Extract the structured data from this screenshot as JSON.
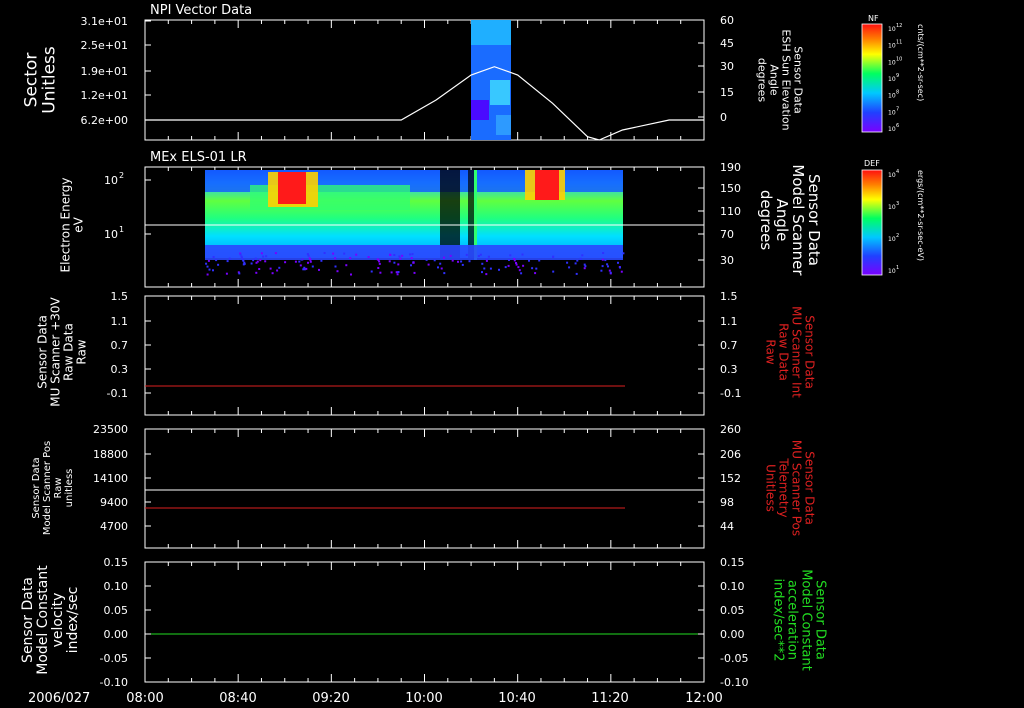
{
  "date_label": "2006/027",
  "time_ticks": [
    "08:00",
    "08:40",
    "09:20",
    "10:00",
    "10:40",
    "11:20",
    "12:00"
  ],
  "panels": [
    {
      "title": "NPI Vector Data",
      "left_label": [
        "Sector",
        "Unitless"
      ],
      "right_label": [
        "Sensor Data",
        "ESH Sun Elevation",
        "Angle",
        "degrees"
      ],
      "left_ticks": [
        "3.1e+01",
        "2.5e+01",
        "1.9e+01",
        "1.2e+01",
        "6.2e+00"
      ],
      "right_ticks": [
        "60",
        "45",
        "30",
        "15",
        "0"
      ]
    },
    {
      "title": "MEx ELS-01 LR",
      "left_label": [
        "Electron Energy",
        "eV"
      ],
      "right_label": [
        "Sensor Data",
        "Model Scanner",
        "Angle",
        "degrees"
      ],
      "left_ticks": [
        "10",
        "10",
        "1",
        "2"
      ],
      "left_tick_text": [
        {
          "base": "10",
          "exp": "2"
        },
        {
          "base": "10",
          "exp": "1"
        }
      ],
      "right_ticks": [
        "190",
        "150",
        "110",
        "70",
        "30"
      ]
    },
    {
      "title": "",
      "left_label": [
        "Sensor Data",
        "MU Scanner +30V",
        "Raw Data",
        "Raw"
      ],
      "right_label": [
        "Sensor Data",
        "MU Scanner Int",
        "Raw Data",
        "Raw"
      ],
      "left_ticks": [
        "1.5",
        "1.1",
        "0.7",
        "0.3",
        "-0.1"
      ],
      "right_ticks": [
        "1.5",
        "1.1",
        "0.7",
        "0.3",
        "-0.1"
      ]
    },
    {
      "title": "",
      "left_label": [
        "Sensor Data",
        "Model Scanner Pos",
        "Raw",
        "unitless"
      ],
      "right_label": [
        "Sensor Data",
        "MU Scanner Pos",
        "Telemetry",
        "Unitless"
      ],
      "left_ticks": [
        "23500",
        "18800",
        "14100",
        "9400",
        "4700"
      ],
      "right_ticks": [
        "260",
        "206",
        "152",
        "98",
        "44"
      ]
    },
    {
      "title": "",
      "left_label": [
        "Sensor Data",
        "Model Constant",
        "velocity",
        "index/sec"
      ],
      "right_label": [
        "Sensor Data",
        "Model Constant",
        "acceleration",
        "index/sec**2"
      ],
      "left_ticks": [
        "0.15",
        "0.10",
        "0.05",
        "0.00",
        "-0.05",
        "-0.10"
      ],
      "right_ticks": [
        "0.15",
        "0.10",
        "0.05",
        "0.00",
        "-0.05",
        "-0.10"
      ]
    }
  ],
  "colorbars": [
    {
      "tag": "NF",
      "unit": "cnts/(cm**2-sr-sec)",
      "ticks": [
        {
          "base": "10",
          "exp": "12"
        },
        {
          "base": "10",
          "exp": "11"
        },
        {
          "base": "10",
          "exp": "10"
        },
        {
          "base": "10",
          "exp": "9"
        },
        {
          "base": "10",
          "exp": "8"
        },
        {
          "base": "10",
          "exp": "7"
        },
        {
          "base": "10",
          "exp": "6"
        }
      ]
    },
    {
      "tag": "DEF",
      "unit": "ergs/(cm**2-sr-sec-eV)",
      "ticks": [
        {
          "base": "10",
          "exp": "4"
        },
        {
          "base": "10",
          "exp": "3"
        },
        {
          "base": "10",
          "exp": "2"
        },
        {
          "base": "10",
          "exp": "1"
        }
      ]
    }
  ],
  "colors": {
    "background": "#000000",
    "axis": "#ffffff",
    "red_trace": "#dd2020",
    "green_trace": "#22dd22"
  },
  "chart_data": [
    {
      "type": "line",
      "panel": "NPI Vector Data",
      "series": [
        {
          "name": "ESH Sun Elevation Angle",
          "axis": "right",
          "x": [
            "08:00",
            "09:50",
            "10:05",
            "10:20",
            "10:30",
            "10:40",
            "10:55",
            "11:10",
            "11:15",
            "11:25",
            "11:45",
            "12:00"
          ],
          "values": [
            0,
            0,
            12,
            27,
            32,
            27,
            10,
            -10,
            -12,
            -6,
            0,
            0
          ]
        }
      ],
      "yrange_right": [
        -12,
        60
      ]
    },
    {
      "type": "heatmap",
      "panel": "MEx ELS-01 LR",
      "ylabel": "Electron Energy eV",
      "yscale": "log",
      "time_range": [
        "08:35",
        "11:25"
      ]
    },
    {
      "type": "line",
      "panel": "MU Scanner",
      "series": [
        {
          "color": "red",
          "x": [
            "08:00",
            "11:25"
          ],
          "values": [
            -0.1,
            -0.1
          ]
        }
      ],
      "ylim": [
        -0.1,
        1.5
      ]
    },
    {
      "type": "line",
      "panel": "Scanner Pos",
      "series": [
        {
          "color": "white",
          "x": [
            "08:00",
            "12:00"
          ],
          "values": [
            12500,
            12500
          ]
        },
        {
          "color": "red",
          "x": [
            "08:00",
            "11:25"
          ],
          "values": [
            9400,
            9400
          ]
        }
      ],
      "ylim": [
        0,
        23500
      ]
    },
    {
      "type": "line",
      "panel": "Model Constant",
      "series": [
        {
          "color": "green",
          "x": [
            "08:00",
            "12:00"
          ],
          "values": [
            0,
            0
          ]
        }
      ],
      "ylim": [
        -0.1,
        0.15
      ]
    }
  ]
}
